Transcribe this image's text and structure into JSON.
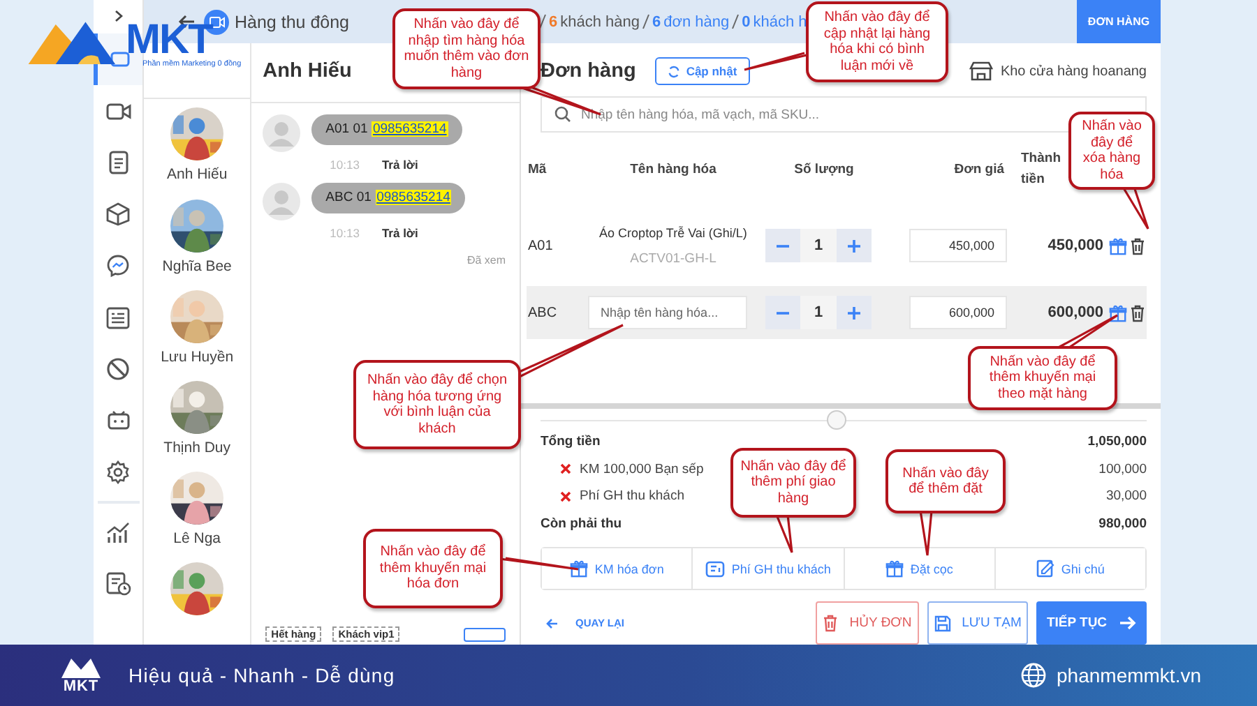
{
  "logo": {
    "name": "MKT",
    "tagline": "Phần mềm Marketing 0 đồng"
  },
  "sidebar_items": [
    {
      "selected": true
    },
    {
      "selected": false
    },
    {
      "selected": false
    },
    {
      "selected": false
    },
    {
      "selected": false
    },
    {
      "selected": false
    },
    {
      "selected": false
    },
    {
      "selected": false
    },
    {
      "selected": false
    },
    {
      "selected": false
    },
    {
      "selected": false
    }
  ],
  "top_bar": {
    "title": "Hàng thu đông",
    "stats": [
      {
        "count": "6",
        "label": "khách hàng",
        "color": "#f07a2a"
      },
      {
        "count": "6",
        "label": "đơn hàng",
        "color": "#3b82f6"
      },
      {
        "count": "0",
        "label": "khách h",
        "color": "#3b82f6"
      }
    ],
    "order_button": "ĐƠN HÀNG"
  },
  "contacts": [
    {
      "name": "Anh Hiếu"
    },
    {
      "name": "Nghĩa Bee"
    },
    {
      "name": "Lưu Huyền"
    },
    {
      "name": "Thịnh Duy"
    },
    {
      "name": "Lê Nga"
    },
    {
      "kind": "picture"
    }
  ],
  "chat": {
    "title": "Anh Hiếu",
    "messages": [
      {
        "text": "A01 01",
        "phone": "0985635214",
        "time": "10:13",
        "reply": "Trả lời"
      },
      {
        "text": "ABC 01",
        "phone": "0985635214",
        "time": "10:13",
        "reply": "Trả lời"
      }
    ],
    "seen": "Đã xem",
    "tags": [
      "Hết hàng",
      "Khách vip1"
    ]
  },
  "order": {
    "title": "Đơn hàng",
    "update_button": "Cập nhật",
    "store": "Kho cửa hàng hoanang",
    "search": {
      "placeholder": "Nhập tên hàng hóa, mã vạch, mã SKU..."
    },
    "columns": [
      "Mã",
      "Tên hàng hóa",
      "Số lượng",
      "Đơn giá",
      "Thành tiền"
    ],
    "rows": [
      {
        "kind": "product",
        "code": "A01",
        "name": "Áo Croptop Trễ Vai (Ghi/L)",
        "sku": "ACTV01-GH-L",
        "qty": "1",
        "price": "450,000",
        "total": "450,000",
        "selected": false
      },
      {
        "kind": "input",
        "code": "ABC",
        "placeholder": "Nhập tên hàng hóa...",
        "qty": "1",
        "price": "600,000",
        "total": "600,000",
        "selected": true
      }
    ],
    "total": {
      "label": "Tổng tiền",
      "value": "1,050,000"
    },
    "adjustments": [
      {
        "label": "KM 100,000 Bạn sếp",
        "value": "100,000"
      },
      {
        "label": "Phí GH thu khách",
        "value": "30,000"
      }
    ],
    "remaining": {
      "label": "Còn phải thu",
      "value": "980,000"
    },
    "actions": [
      "KM hóa đơn",
      "Phí GH thu khách",
      "Đặt cọc",
      "Ghi chú"
    ],
    "back": "QUAY LẠI",
    "buttons": [
      {
        "label": "HỦY ĐƠN",
        "kind": "danger"
      },
      {
        "label": "LƯU TẠM",
        "kind": "outline"
      },
      {
        "label": "TIẾP TỤC",
        "kind": "primary"
      }
    ]
  },
  "callouts": [
    "Nhấn vào đây để nhập tìm hàng hóa muốn thêm vào đơn hàng",
    "Nhấn vào đây để cập nhật lại hàng hóa khi có bình luận mới về",
    "Nhấn vào đây để xóa hàng hóa",
    "Nhấn vào đây để chọn hàng hóa tương ứng với bình luận của khách",
    "Nhấn vào đây để thêm khuyến mại theo mặt hàng",
    "Nhấn vào đây để thêm phí giao hàng",
    "Nhấn vào đây để thêm đặt",
    "Nhấn vào đây để thêm khuyến mại hóa đơn"
  ],
  "footer": {
    "logo": "MKT",
    "slogan": "Hiệu quả - Nhanh - Dễ dùng",
    "website": "phanmemmkt.vn"
  }
}
